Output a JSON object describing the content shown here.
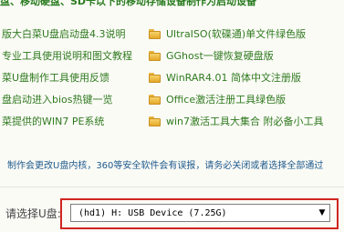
{
  "top_text": "盘、移动硬盘、SD卡以下的移动存储设备制作为启动设备",
  "documents": [
    {
      "label": "版大白菜U盘启动盘4.3说明",
      "icon": "folder-icon"
    },
    {
      "label": "UltraISO(软碟通)单文件绿色版",
      "icon": "folder-icon"
    },
    {
      "label": "专业工具使用说明和图文教程",
      "icon": "folder-icon"
    },
    {
      "label": "GGhost一键恢复硬盘版",
      "icon": "folder-icon"
    },
    {
      "label": "菜U盘制作工具使用反馈",
      "icon": "folder-icon"
    },
    {
      "label": "WinRAR4.01 简体中文注册版",
      "icon": "folder-icon"
    },
    {
      "label": "盘启动进入bios热键一览",
      "icon": "folder-icon"
    },
    {
      "label": "Office激活注册工具绿色版",
      "icon": "folder-icon"
    },
    {
      "label": "菜提供的WIN7 PE系统",
      "icon": "folder-icon"
    },
    {
      "label": "win7激活工具大集合 附必备小工具",
      "icon": "folder-icon"
    }
  ],
  "notice": "制作会更改U盘内核，360等安全软件会有误报，请务必关闭或者选择全部通过",
  "usb_select": {
    "label": "请选择U盘:",
    "selected_value": "(hd1) H: USB Device (7.25G)"
  },
  "colors": {
    "link_green": "#2f7a1f",
    "notice_blue": "#1f5a8c",
    "highlight_red": "#d0261f"
  }
}
